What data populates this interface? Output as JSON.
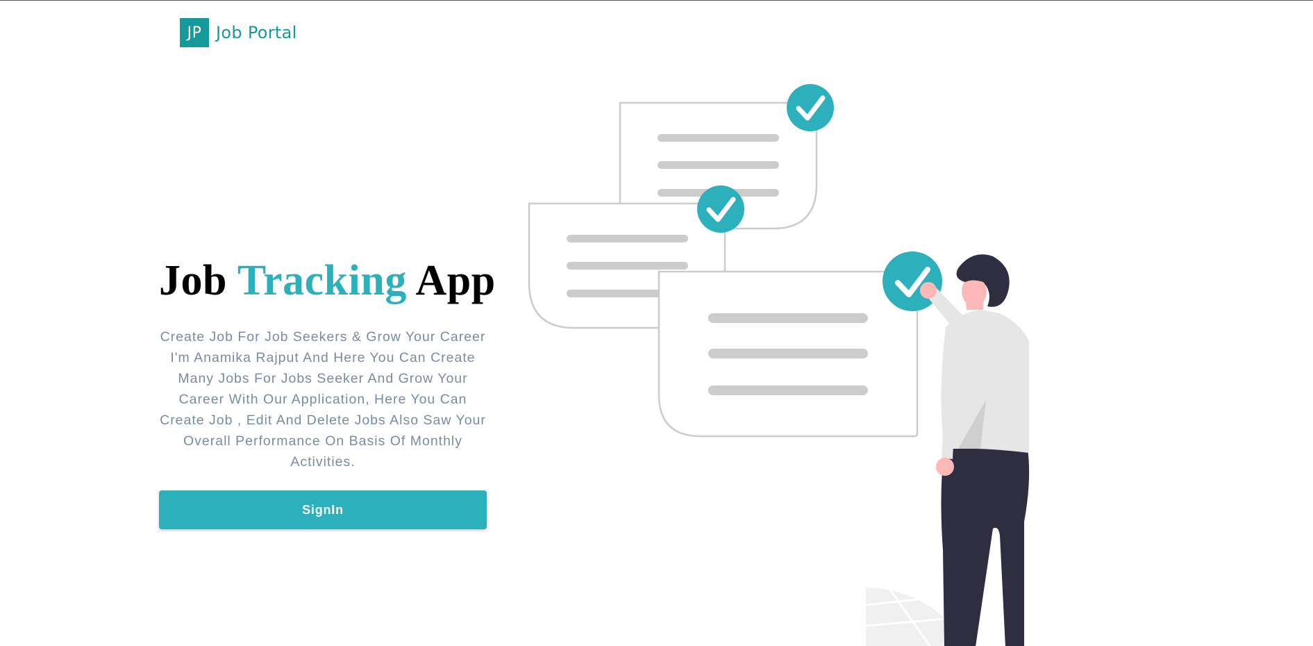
{
  "nav": {
    "logo_text": "JP",
    "brand_name": "Job Portal"
  },
  "hero": {
    "title_part1": "Job",
    "title_accent": "Tracking",
    "title_part2": "App",
    "description": "Create Job For Job Seekers & Grow Your Career I'm Anamika Rajput And Here You Can Create Many Jobs For Jobs Seeker And Grow Your Career With Our Application, Here You Can Create Job , Edit And Delete Jobs Also Saw Your Overall Performance On Basis Of Monthly Activities.",
    "signin_label": "SignIn"
  },
  "illustration": {
    "name": "job-tracking-illustration",
    "icons": [
      "check-circle-icon",
      "check-circle-icon",
      "check-circle-icon"
    ]
  },
  "colors": {
    "primary": "#2cb1bc",
    "brand": "#15999b",
    "text_muted": "#7a8ba3",
    "title": "#000000"
  }
}
